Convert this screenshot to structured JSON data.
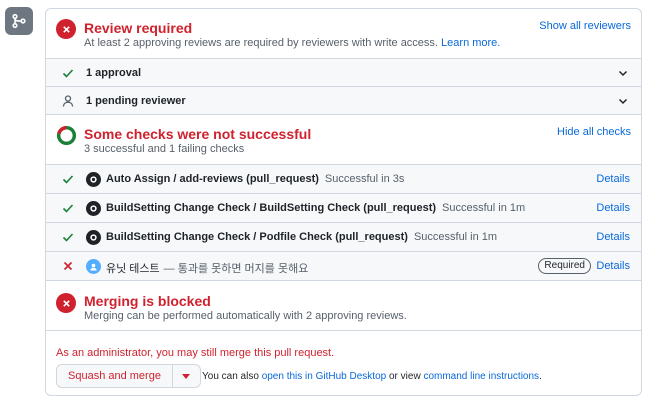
{
  "review": {
    "title": "Review required",
    "desc": "At least 2 approving reviews are required by reviewers with write access.",
    "learn_more": "Learn more.",
    "show_all": "Show all reviewers",
    "approvals_label": "1 approval",
    "pending_label": "1 pending reviewer"
  },
  "checks": {
    "title": "Some checks were not successful",
    "summary": "3 successful and 1 failing checks",
    "hide_all": "Hide all checks",
    "items": [
      {
        "name": "Auto Assign / add-reviews (pull_request)",
        "status": "Successful in 3s",
        "details": "Details",
        "result": "success"
      },
      {
        "name": "BuildSetting Change Check / BuildSetting Check (pull_request)",
        "status": "Successful in 1m",
        "details": "Details",
        "result": "success"
      },
      {
        "name": "BuildSetting Change Check / Podfile Check (pull_request)",
        "status": "Successful in 1m",
        "details": "Details",
        "result": "success"
      },
      {
        "name": "유닛 테스트",
        "status": "— 통과를 못하면 머지를 못해요",
        "details": "Details",
        "badge": "Required",
        "result": "failure"
      }
    ]
  },
  "merge": {
    "title": "Merging is blocked",
    "desc": "Merging can be performed automatically with 2 approving reviews.",
    "admin_notice": "As an administrator, you may still merge this pull request.",
    "button_label": "Squash and merge",
    "alt_prefix": "You can also",
    "desktop_link": "open this in GitHub Desktop",
    "or_view": "or view",
    "cli_link": "command line instructions",
    "period": "."
  },
  "colors": {
    "danger": "#cf222e",
    "success": "#1a7f37",
    "link": "#0969da",
    "muted": "#57606a"
  },
  "icons": [
    "git-merge-icon",
    "x-circle-icon",
    "check-icon",
    "person-icon",
    "chevron-down-icon",
    "donut-status-icon",
    "github-app-icon",
    "x-icon",
    "triangle-down-icon"
  ]
}
